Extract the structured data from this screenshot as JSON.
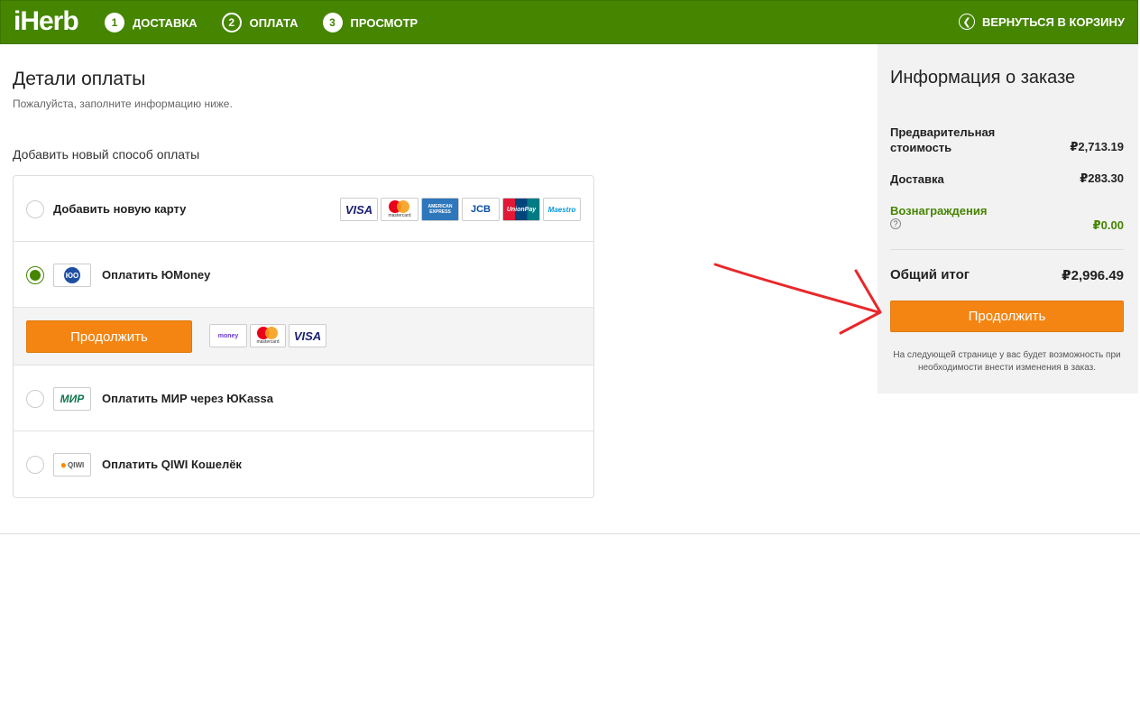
{
  "header": {
    "logo": "iHerb",
    "steps": [
      {
        "num": "1",
        "label": "ДОСТАВКА"
      },
      {
        "num": "2",
        "label": "ОПЛАТА"
      },
      {
        "num": "3",
        "label": "ПРОСМОТР"
      }
    ],
    "back_label": "ВЕРНУТЬСЯ В КОРЗИНУ",
    "brand_color": "#458500"
  },
  "main": {
    "title": "Детали оплаты",
    "subtitle": "Пожалуйста, заполните информацию ниже.",
    "add_method_label": "Добавить новый способ оплаты",
    "methods": [
      {
        "label": "Добавить новую карту",
        "selected": false
      },
      {
        "label": "Оплатить ЮMoney",
        "logo": "ЮО",
        "selected": true
      },
      {
        "label": "Оплатить МИР через ЮKassa",
        "logo": "МИР",
        "selected": false
      },
      {
        "label": "Оплатить QIWI Кошелёк",
        "logo": "QIWI",
        "selected": false
      }
    ],
    "card_logos": [
      "VISA",
      "mastercard",
      "AMERICAN EXPRESS",
      "JCB",
      "UnionPay",
      "Maestro"
    ],
    "continue_label": "Продолжить",
    "continue_logos": [
      "money",
      "mastercard",
      "VISA"
    ]
  },
  "summary": {
    "title": "Информация о заказе",
    "subtotal_label": "Предварительная стоимость",
    "subtotal_value": "₽2,713.19",
    "shipping_label": "Доставка",
    "shipping_value": "₽283.30",
    "rewards_label": "Вознаграждения",
    "rewards_value": "₽0.00",
    "total_label": "Общий итог",
    "total_value": "₽2,996.49",
    "continue_label": "Продолжить",
    "note": "На следующей странице у вас будет возможность при необходимости внести изменения в заказ.",
    "accent_color": "#f48512"
  }
}
